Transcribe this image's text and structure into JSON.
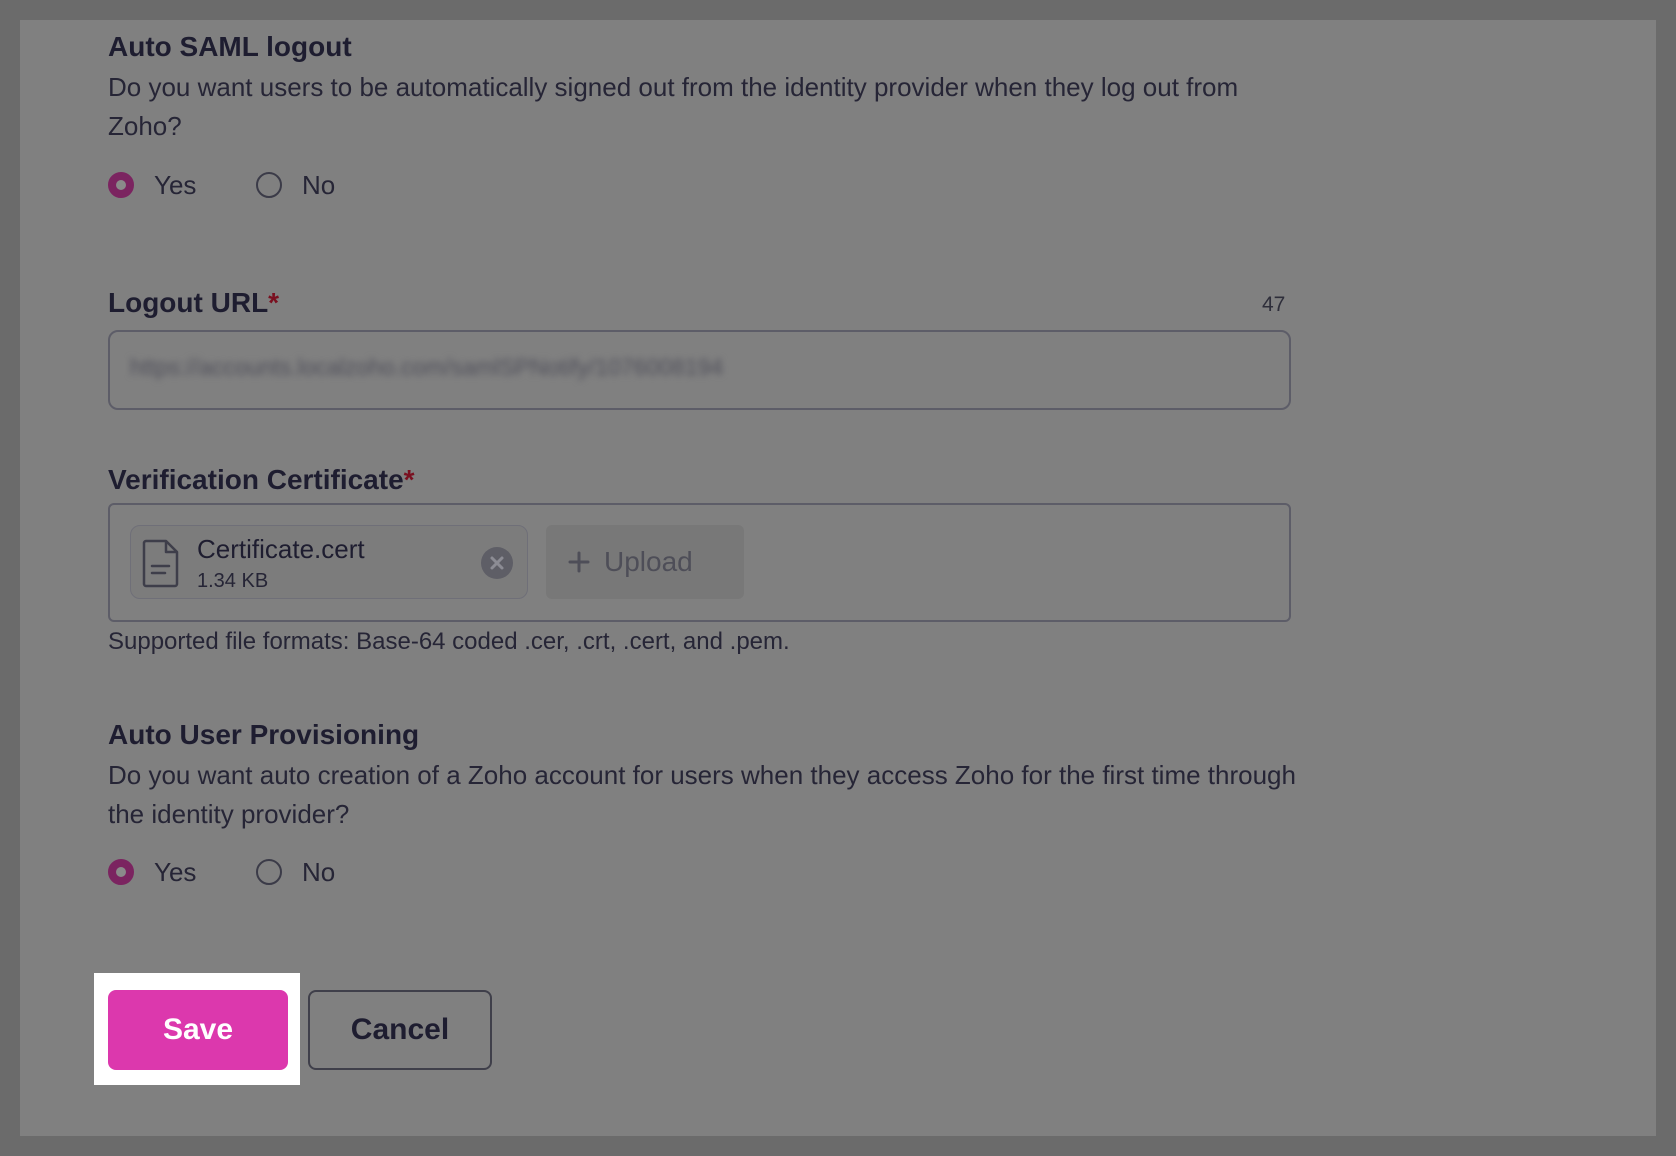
{
  "auto_saml_logout": {
    "title": "Auto SAML logout",
    "description": "Do you want users to be automatically signed out from the identity provider when they log out from Zoho?",
    "options": [
      "Yes",
      "No"
    ],
    "selected": "Yes"
  },
  "logout_url": {
    "label": "Logout URL",
    "required_mark": "*",
    "char_count": "47",
    "value": "https://accounts.localzoho.com/samlSPNotify/1076008194"
  },
  "verification_certificate": {
    "label": "Verification Certificate",
    "required_mark": "*",
    "file_name": "Certificate.cert",
    "file_size": "1.34 KB",
    "upload_label": "Upload",
    "hint": "Supported file formats: Base-64 coded .cer, .crt, .cert, and .pem."
  },
  "auto_user_provisioning": {
    "title": "Auto User Provisioning",
    "description": "Do you want auto creation of a Zoho account for users when they access Zoho for the first time through the identity provider?",
    "options": [
      "Yes",
      "No"
    ],
    "selected": "Yes"
  },
  "actions": {
    "save_label": "Save",
    "cancel_label": "Cancel"
  },
  "icons": {
    "file": "file-document-icon",
    "remove": "close-circle-icon",
    "upload": "plus-icon"
  },
  "colors": {
    "accent": "#dc38ad",
    "radio_checked": "#7b2460",
    "required": "#7a1020",
    "highlight": "#ffffff"
  }
}
